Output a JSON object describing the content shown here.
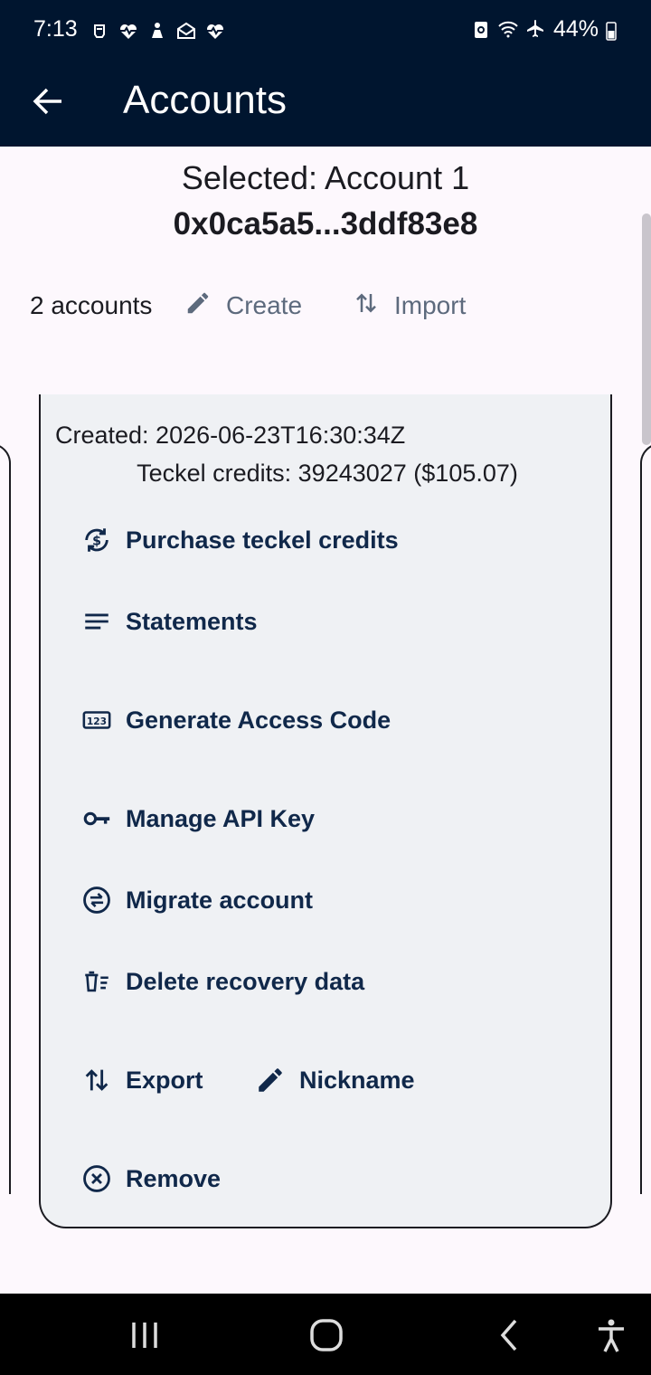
{
  "status_bar": {
    "time": "7:13",
    "battery_percent": "44%",
    "left_icons": [
      "bell-icon",
      "heart-pulse-icon",
      "figure-icon",
      "mail-open-icon",
      "heart-pulse-icon"
    ],
    "right_icons": [
      "battery-saver-icon",
      "wifi-icon",
      "airplane-icon",
      "battery-icon"
    ]
  },
  "app_bar": {
    "title": "Accounts",
    "back_icon": "arrow-left-icon"
  },
  "selected": {
    "label": "Selected: Account 1",
    "address": "0x0ca5a5...3ddf83e8"
  },
  "actions": {
    "accounts_count": "2 accounts",
    "create_label": "Create",
    "import_label": "Import"
  },
  "card": {
    "created": "Created: 2026-06-23T16:30:34Z",
    "credits": "Teckel credits: 39243027 ($105.07)",
    "items": [
      {
        "label": "Purchase teckel credits",
        "icon": "currency-exchange-icon"
      },
      {
        "label": "Statements",
        "icon": "notes-icon"
      },
      {
        "label": "Generate Access Code",
        "icon": "pin-123-icon"
      },
      {
        "label": "Manage API Key",
        "icon": "key-icon"
      },
      {
        "label": "Migrate account",
        "icon": "swap-circle-icon"
      },
      {
        "label": "Delete recovery data",
        "icon": "delete-sweep-icon"
      },
      {
        "label": "Export",
        "icon": "import-export-icon"
      },
      {
        "label": "Nickname",
        "icon": "pencil-icon"
      },
      {
        "label": "Remove",
        "icon": "cancel-circle-icon"
      }
    ]
  },
  "colors": {
    "app_bar_bg": "#00152f",
    "page_bg": "#fdf8fd",
    "card_bg": "#eff1f4",
    "menu_text": "#10284a",
    "muted_button": "#5d6a7d"
  }
}
